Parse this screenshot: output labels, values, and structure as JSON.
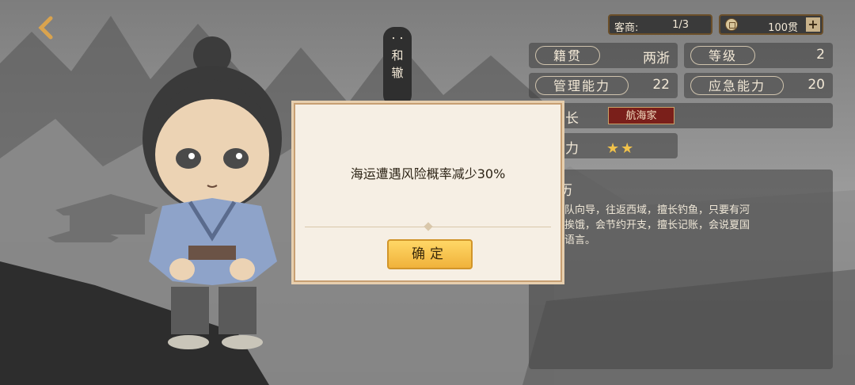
{
  "resources": {
    "merchant_label": "客商:",
    "merchant_value": "1/3",
    "money_value": "100贯",
    "plus_label": "+"
  },
  "stats": {
    "hometown_label": "籍贯",
    "hometown_value": "两浙",
    "level_label": "等级",
    "level_value": "2",
    "management_label": "管理能力",
    "management_value": "22",
    "emergency_label": "应急能力",
    "emergency_value": "20",
    "specialty_label_partial": "长",
    "specialty_tag": "航海家",
    "ability_label_partial": "力",
    "stars": "★★"
  },
  "character": {
    "name_dots": "・・",
    "name_line1": "和",
    "name_line2": "辙"
  },
  "bio": {
    "title_partial": "历",
    "text_line1": "商队向导，往返西域，擅长钓鱼，只要有河",
    "text_line2": "会挨饿，会节约开支，擅长记账，会说夏国",
    "text_line3": "国语言。"
  },
  "modal": {
    "message": "海运遭遇风险概率减少30%",
    "confirm_label": "确定"
  },
  "colors": {
    "accent_gold": "#f0b23b",
    "tag_red": "#7a1f1a",
    "star_gold": "#f1c24a"
  }
}
